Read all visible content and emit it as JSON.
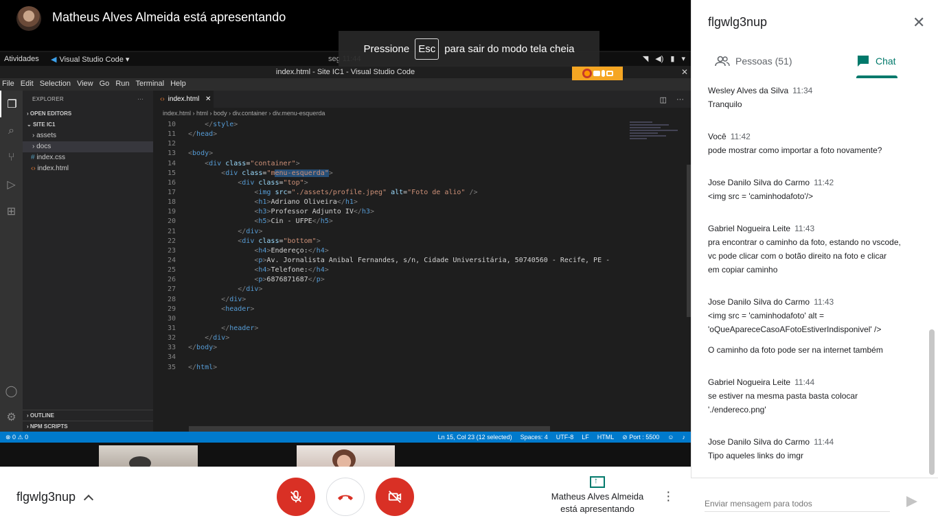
{
  "presenter": {
    "name": "Matheus Alves Almeida está apresentando"
  },
  "toast": {
    "before": "Pressione",
    "key": "Esc",
    "after": "para sair do modo tela cheia"
  },
  "ubuntu": {
    "activities": "Atividades",
    "app": "Visual Studio Code ▾",
    "clock": "seg 11:44"
  },
  "vscode": {
    "title": "index.html - Site IC1 - Visual Studio Code",
    "menu": [
      "File",
      "Edit",
      "Selection",
      "View",
      "Go",
      "Run",
      "Terminal",
      "Help"
    ],
    "sidebar": {
      "header": "EXPLORER",
      "open_editors": "OPEN EDITORS",
      "folder": "SITE IC1",
      "items": [
        "assets",
        "docs",
        "index.css",
        "index.html"
      ],
      "outline": "OUTLINE",
      "npm": "NPM SCRIPTS"
    },
    "tab": "index.html",
    "breadcrumb": [
      "index.html",
      "html",
      "body",
      "div.container",
      "div.menu-esquerda"
    ],
    "code": [
      {
        "n": "10",
        "html": "<span class='tx'>    </span><span class='pn'>&lt;/</span><span class='tg'>style</span><span class='pn'>&gt;</span>"
      },
      {
        "n": "11",
        "html": "<span class='pn'>&lt;/</span><span class='tg'>head</span><span class='pn'>&gt;</span>"
      },
      {
        "n": "12",
        "html": ""
      },
      {
        "n": "13",
        "html": "<span class='pn'>&lt;</span><span class='tg'>body</span><span class='pn'>&gt;</span>"
      },
      {
        "n": "14",
        "html": "    <span class='pn'>&lt;</span><span class='tg'>div</span> <span class='at'>class</span><span class='tx'>=</span><span class='st'>\"container\"</span><span class='pn'>&gt;</span>"
      },
      {
        "n": "15",
        "html": "        <span class='pn'>&lt;</span><span class='tg'>div</span> <span class='at'>class</span><span class='tx'>=</span><span class='st'>\"m<span class='sel-hl'>enu-esquerda\"</span></span><span class='pn'>&gt;</span>"
      },
      {
        "n": "16",
        "html": "            <span class='pn'>&lt;</span><span class='tg'>div</span> <span class='at'>class</span><span class='tx'>=</span><span class='st'>\"top\"</span><span class='pn'>&gt;</span>"
      },
      {
        "n": "17",
        "html": "                <span class='pn'>&lt;</span><span class='tg'>img</span> <span class='at'>src</span><span class='tx'>=</span><span class='st'>\"./assets/profile.jpeg\"</span> <span class='at'>alt</span><span class='tx'>=</span><span class='st'>\"Foto de alio\"</span> <span class='pn'>/&gt;</span>"
      },
      {
        "n": "18",
        "html": "                <span class='pn'>&lt;</span><span class='tg'>h1</span><span class='pn'>&gt;</span><span class='tx'>Adriano Oliveira</span><span class='pn'>&lt;/</span><span class='tg'>h1</span><span class='pn'>&gt;</span>"
      },
      {
        "n": "19",
        "html": "                <span class='pn'>&lt;</span><span class='tg'>h3</span><span class='pn'>&gt;</span><span class='tx'>Professor Adjunto IV</span><span class='pn'>&lt;/</span><span class='tg'>h3</span><span class='pn'>&gt;</span>"
      },
      {
        "n": "20",
        "html": "                <span class='pn'>&lt;</span><span class='tg'>h5</span><span class='pn'>&gt;</span><span class='tx'>Cin - UFPE</span><span class='pn'>&lt;/</span><span class='tg'>h5</span><span class='pn'>&gt;</span>"
      },
      {
        "n": "21",
        "html": "            <span class='pn'>&lt;/</span><span class='tg'>div</span><span class='pn'>&gt;</span>"
      },
      {
        "n": "22",
        "html": "            <span class='pn'>&lt;</span><span class='tg'>div</span> <span class='at'>class</span><span class='tx'>=</span><span class='st'>\"bottom\"</span><span class='pn'>&gt;</span>"
      },
      {
        "n": "23",
        "html": "                <span class='pn'>&lt;</span><span class='tg'>h4</span><span class='pn'>&gt;</span><span class='tx'>Endereço:</span><span class='pn'>&lt;/</span><span class='tg'>h4</span><span class='pn'>&gt;</span>"
      },
      {
        "n": "24",
        "html": "                <span class='pn'>&lt;</span><span class='tg'>p</span><span class='pn'>&gt;</span><span class='tx'>Av. Jornalista Anibal Fernandes, s/n, Cidade Universitária, 50740560 - Recife, PE -</span>"
      },
      {
        "n": "25",
        "html": "                <span class='pn'>&lt;</span><span class='tg'>h4</span><span class='pn'>&gt;</span><span class='tx'>Telefone:</span><span class='pn'>&lt;/</span><span class='tg'>h4</span><span class='pn'>&gt;</span>"
      },
      {
        "n": "26",
        "html": "                <span class='pn'>&lt;</span><span class='tg'>p</span><span class='pn'>&gt;</span><span class='tx'>6876871687</span><span class='pn'>&lt;/</span><span class='tg'>p</span><span class='pn'>&gt;</span>"
      },
      {
        "n": "27",
        "html": "            <span class='pn'>&lt;/</span><span class='tg'>div</span><span class='pn'>&gt;</span>"
      },
      {
        "n": "28",
        "html": "        <span class='pn'>&lt;/</span><span class='tg'>div</span><span class='pn'>&gt;</span>"
      },
      {
        "n": "29",
        "html": "        <span class='pn'>&lt;</span><span class='tg'>header</span><span class='pn'>&gt;</span>"
      },
      {
        "n": "30",
        "html": ""
      },
      {
        "n": "31",
        "html": "        <span class='pn'>&lt;/</span><span class='tg'>header</span><span class='pn'>&gt;</span>"
      },
      {
        "n": "32",
        "html": "    <span class='pn'>&lt;/</span><span class='tg'>div</span><span class='pn'>&gt;</span>"
      },
      {
        "n": "33",
        "html": "<span class='pn'>&lt;/</span><span class='tg'>body</span><span class='pn'>&gt;</span>"
      },
      {
        "n": "34",
        "html": ""
      },
      {
        "n": "35",
        "html": "<span class='pn'>&lt;/</span><span class='tg'>html</span><span class='pn'>&gt;</span>"
      }
    ],
    "status": {
      "left": "⊗ 0 ⚠ 0",
      "position": "Ln 15, Col 23 (12 selected)",
      "spaces": "Spaces: 4",
      "encoding": "UTF-8",
      "eol": "LF",
      "lang": "HTML",
      "port": "⊘ Port : 5500"
    }
  },
  "controls": {
    "meeting_code": "flgwlg3nup",
    "present_line1": "Matheus Alves Almeida",
    "present_line2": "está apresentando"
  },
  "panel": {
    "title": "flgwlg3nup",
    "people_tab": "Pessoas (51)",
    "chat_tab": "Chat",
    "compose_placeholder": "Enviar mensagem para todos",
    "messages": [
      {
        "who": "Wesley Alves da Silva",
        "when": "11:34",
        "lines": [
          "Tranquilo"
        ]
      },
      {
        "who": "Você",
        "when": "11:42",
        "lines": [
          "pode mostrar como importar a foto novamente?"
        ]
      },
      {
        "who": "Jose Danilo Silva do Carmo",
        "when": "11:42",
        "lines": [
          "<img src = 'caminhodafoto'/>"
        ]
      },
      {
        "who": "Gabriel Nogueira Leite",
        "when": "11:43",
        "lines": [
          "pra encontrar o caminho da foto, estando no vscode,",
          "vc pode clicar com o botão direito na foto e clicar",
          "em copiar caminho"
        ]
      },
      {
        "who": "Jose Danilo Silva do Carmo",
        "when": "11:43",
        "lines": [
          "<img src = 'caminhodafoto' alt =",
          "'oQueApareceCasoAFotoEstiverIndisponivel' />",
          "",
          "O caminho da foto pode ser na internet também"
        ]
      },
      {
        "who": "Gabriel Nogueira Leite",
        "when": "11:44",
        "lines": [
          "se estiver na mesma pasta basta colocar",
          "'./endereco.png'"
        ]
      },
      {
        "who": "Jose Danilo Silva do Carmo",
        "when": "11:44",
        "lines": [
          "Tipo aqueles links do imgr"
        ]
      }
    ]
  }
}
